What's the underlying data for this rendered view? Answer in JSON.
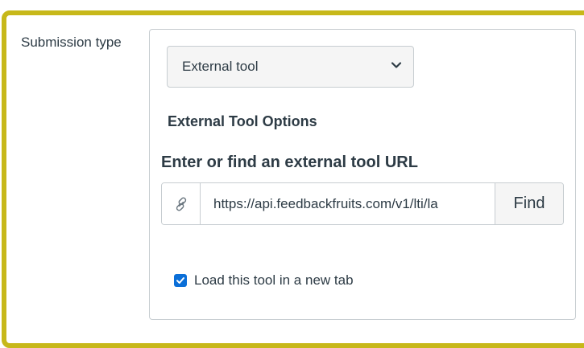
{
  "form": {
    "submission_type_label": "Submission type",
    "submission_type_value": "External tool",
    "external_tool_options_title": "External Tool Options",
    "url_label": "Enter or find an external tool URL",
    "url_value": "https://api.feedbackfruits.com/v1/lti/la",
    "find_button": "Find",
    "new_tab_label": "Load this tool in a new tab",
    "new_tab_checked": true
  },
  "icons": {
    "select_chevron": "chevron-down-icon",
    "url_link": "link-icon",
    "checkbox_check": "checkmark-icon"
  },
  "colors": {
    "highlight_border": "#c7b81a",
    "checkbox_accent": "#0b6fd8",
    "text": "#2d3b45",
    "border": "#c7cdd1"
  }
}
